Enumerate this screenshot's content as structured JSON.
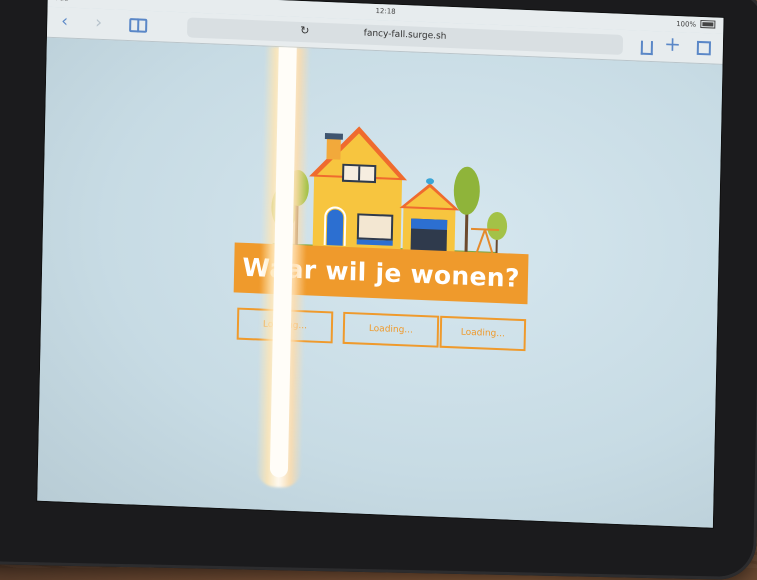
{
  "status": {
    "device": "iPad",
    "time": "12:18",
    "battery": "100%"
  },
  "browser": {
    "url": "fancy-fall.surge.sh",
    "icons": [
      "back-icon",
      "forward-icon",
      "bookmarks-icon",
      "reload-icon",
      "share-icon",
      "new-tab-icon",
      "tabs-icon"
    ]
  },
  "page": {
    "heading": "Waar wil je wonen?",
    "options": [
      "Loading...",
      "Loading...",
      "Loading..."
    ]
  },
  "colors": {
    "accent": "#ef9a2c",
    "page_bg": "#c9dbe3",
    "link_blue": "#5a87c7"
  }
}
